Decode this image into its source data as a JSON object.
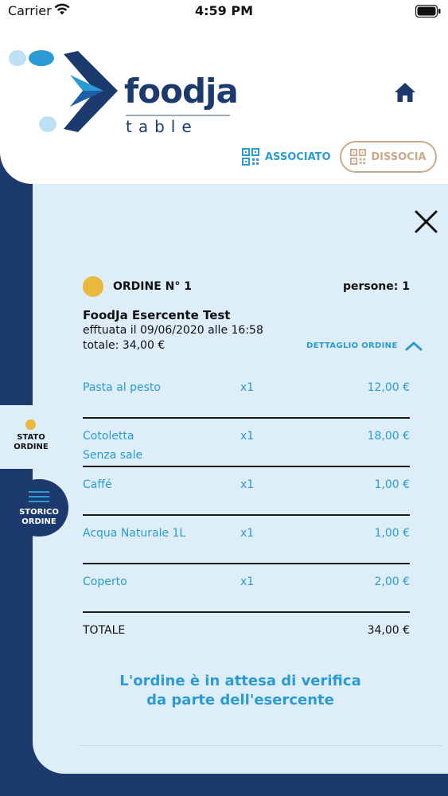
{
  "status_bar": {
    "carrier": "Carrier",
    "time": "4:59 PM"
  },
  "brand": {
    "name": "foodja",
    "subtitle": "table"
  },
  "header": {
    "associated_label": "ASSOCIATO",
    "dissociate_label": "DISSOCIA"
  },
  "order": {
    "label": "ORDINE N° 1",
    "persons": "persone:  1",
    "merchant": "FoodJa Esercente Test",
    "made_at": "efftuata il 09/06/2020 alle 16:58",
    "total": "totale: 34,00 €",
    "detail_label": "DETTAGLIO ORDINE",
    "items": [
      {
        "name": "Pasta al pesto",
        "qty": "x1",
        "price": "12,00 €",
        "note": ""
      },
      {
        "name": "Cotoletta",
        "qty": "x1",
        "price": "18,00 €",
        "note": "Senza sale"
      },
      {
        "name": "Caffé",
        "qty": "x1",
        "price": "1,00 €",
        "note": ""
      },
      {
        "name": "Acqua Naturale 1L",
        "qty": "x1",
        "price": "1,00 €",
        "note": ""
      },
      {
        "name": "Coperto",
        "qty": "x1",
        "price": "2,00 €",
        "note": ""
      }
    ],
    "grand_total_label": "TOTALE",
    "grand_total_value": "34,00 €",
    "waiting_message_line1": "L'ordine è in attesa di verifica",
    "waiting_message_line2": "da parte dell'esercente"
  },
  "side_tabs": {
    "stato_line1": "STATO",
    "stato_line2": "ORDINE",
    "storico_line1": "STORICO",
    "storico_line2": "ORDINE"
  },
  "colors": {
    "navy": "#1d3a6e",
    "accent_blue": "#2b9bd5",
    "panel_bg": "#ddeef9",
    "status_yellow": "#e8b93c",
    "dissocia_tan": "#c9a98a"
  }
}
